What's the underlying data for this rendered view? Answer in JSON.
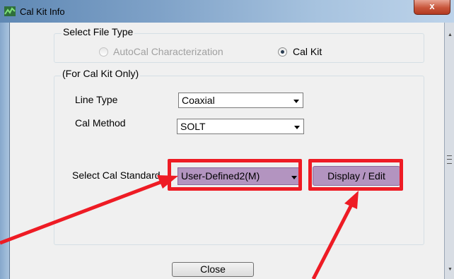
{
  "window": {
    "title": "Cal Kit Info",
    "close_label": "x"
  },
  "file_type": {
    "title": "Select File Type",
    "options": [
      {
        "label": "AutoCal Characterization",
        "checked": false,
        "enabled": false
      },
      {
        "label": "Cal Kit",
        "checked": true,
        "enabled": true
      }
    ]
  },
  "cal_kit": {
    "title": "(For Cal Kit Only)",
    "line_type": {
      "label": "Line Type",
      "value": "Coaxial"
    },
    "cal_method": {
      "label": "Cal Method",
      "value": "SOLT"
    },
    "cal_standard": {
      "label": "Select Cal Standard",
      "value": "User-Defined2(M)"
    },
    "display_edit_label": "Display / Edit"
  },
  "close_button_label": "Close",
  "colors": {
    "highlight_fill": "#b394c0",
    "annotation_red": "#ee1b24",
    "title_bar": "#7fa2c8"
  },
  "icons": {
    "window_icon": "network-analyzer-icon",
    "radio": "radio-button-icon",
    "dropdown": "chevron-down-icon"
  }
}
